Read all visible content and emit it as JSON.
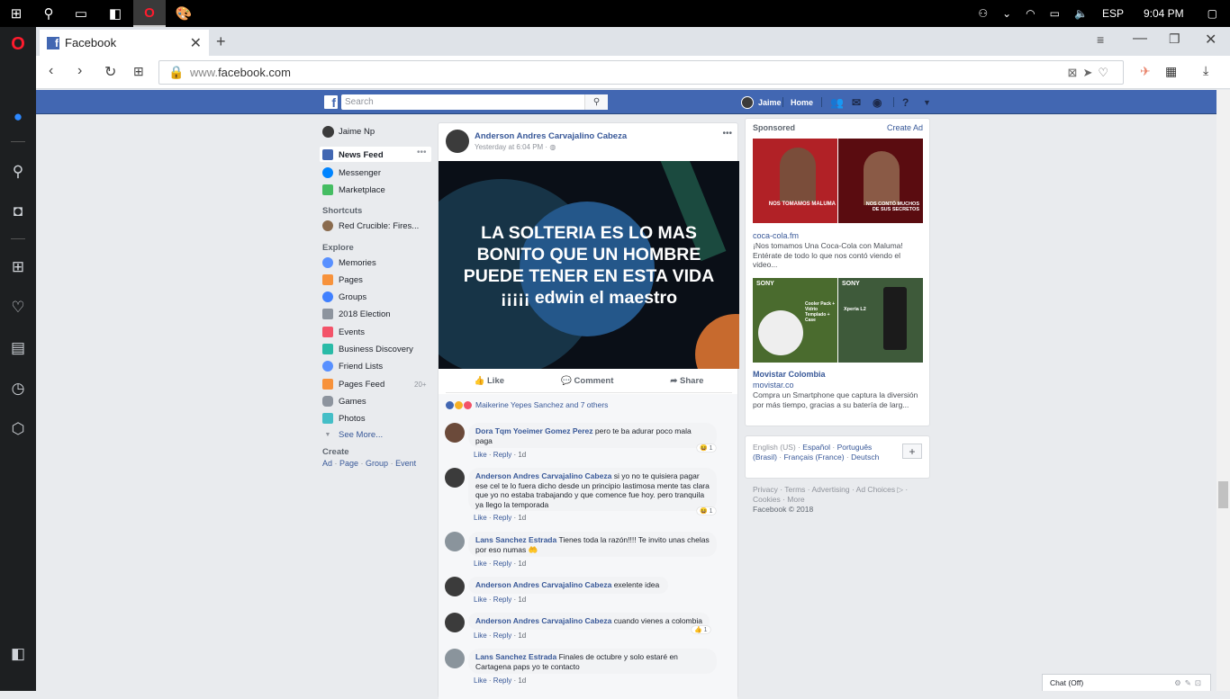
{
  "taskbar": {
    "time": "9:04 PM",
    "lang": "ESP"
  },
  "browser": {
    "tab_title": "Facebook",
    "url_prefix": "www.",
    "url_domain": "facebook.com"
  },
  "fb": {
    "search_placeholder": "Search",
    "user_short": "Jaime",
    "home": "Home"
  },
  "left_nav": {
    "user": "Jaime Np",
    "items": [
      {
        "label": "News Feed",
        "color": "#4267b2"
      },
      {
        "label": "Messenger",
        "color": "#0084ff"
      },
      {
        "label": "Marketplace",
        "color": "#45bd62"
      }
    ],
    "shortcuts_heading": "Shortcuts",
    "shortcut": "Red Crucible: Fires...",
    "explore_heading": "Explore",
    "explore": [
      {
        "label": "Memories",
        "color": "#5890ff"
      },
      {
        "label": "Pages",
        "color": "#f7923b"
      },
      {
        "label": "Groups",
        "color": "#4080ff"
      },
      {
        "label": "2018 Election",
        "color": "#8d949e"
      },
      {
        "label": "Events",
        "color": "#f35369"
      },
      {
        "label": "Business Discovery",
        "color": "#2abba7"
      },
      {
        "label": "Friend Lists",
        "color": "#5890ff"
      },
      {
        "label": "Pages Feed",
        "color": "#f7923b",
        "badge": "20+"
      },
      {
        "label": "Games",
        "color": "#8d949e"
      },
      {
        "label": "Photos",
        "color": "#44bec7"
      }
    ],
    "see_more": "See More...",
    "create_heading": "Create",
    "create_links": [
      "Ad",
      "Page",
      "Group",
      "Event"
    ]
  },
  "post": {
    "author": "Anderson Andres Carvajalino Cabeza",
    "time": "Yesterday at 6:04 PM",
    "image_text_1": "LA SOLTERIA ES LO MAS",
    "image_text_2": "BONITO QUE UN HOMBRE",
    "image_text_3": "PUEDE TENER EN ESTA VIDA",
    "image_text_4": "¡¡¡¡¡ edwin el maestro",
    "like": "Like",
    "comment": "Comment",
    "share": "Share",
    "reactions": "Maikerine Yepes Sanchez and 7 others",
    "comments": [
      {
        "name": "Dora Tqm Yoeimer Gomez Perez",
        "text": "pero te ba adurar poco mala paga",
        "reaction_count": "1"
      },
      {
        "name": "Anderson Andres Carvajalino Cabeza",
        "text": "si yo no te quisiera pagar ese cel te lo fuera dicho desde un principio lastimosa mente tas clara que yo no estaba trabajando y que comence fue hoy. pero tranquila ya llego la temporada",
        "reaction_count": "1"
      },
      {
        "name": "Lans Sanchez Estrada",
        "text": "Tienes toda la razón!!!! Te invito unas chelas por eso numas",
        "reaction_count": ""
      },
      {
        "name": "Anderson Andres Carvajalino Cabeza",
        "text": "exelente idea",
        "reaction_count": ""
      },
      {
        "name": "Anderson Andres Carvajalino Cabeza",
        "text": "cuando vienes a colombia",
        "reaction_count": "1"
      },
      {
        "name": "Lans Sanchez Estrada",
        "text": "Finales de octubre y solo estaré en Cartagena paps yo te contacto",
        "reaction_count": ""
      }
    ],
    "meta_like": "Like",
    "meta_reply": "Reply",
    "meta_time": "1d"
  },
  "right": {
    "sponsored": "Sponsored",
    "create_ad": "Create Ad",
    "ad1_img_text_a": "NOS TOMAMOS MALUMA",
    "ad1_img_text_b": "NOS CONTÓ MUCHOS DE SUS SECRETOS",
    "ad1_source": "coca-cola.fm",
    "ad1_text": "¡Nos tomamos Una Coca-Cola con Maluma! Entérate de todo lo que nos contó viendo el video...",
    "ad2_brand": "SONY",
    "ad2_img_text_a": "Cooler Pack + Vidrio Templado + Case",
    "ad2_img_text_b": "Xperia L2",
    "ad2_title": "Movistar Colombia",
    "ad2_source": "movistar.co",
    "ad2_text": "Compra un Smartphone que captura la diversión por más tiempo, gracias a su batería de larg...",
    "lang_current": "English (US)",
    "lang_links": [
      "Español",
      "Português (Brasil)",
      "Français (France)",
      "Deutsch"
    ],
    "footer_links": [
      "Privacy",
      "Terms",
      "Advertising",
      "Ad Choices",
      "Cookies",
      "More"
    ],
    "copyright": "Facebook © 2018"
  },
  "chat": {
    "label": "Chat (Off)"
  }
}
